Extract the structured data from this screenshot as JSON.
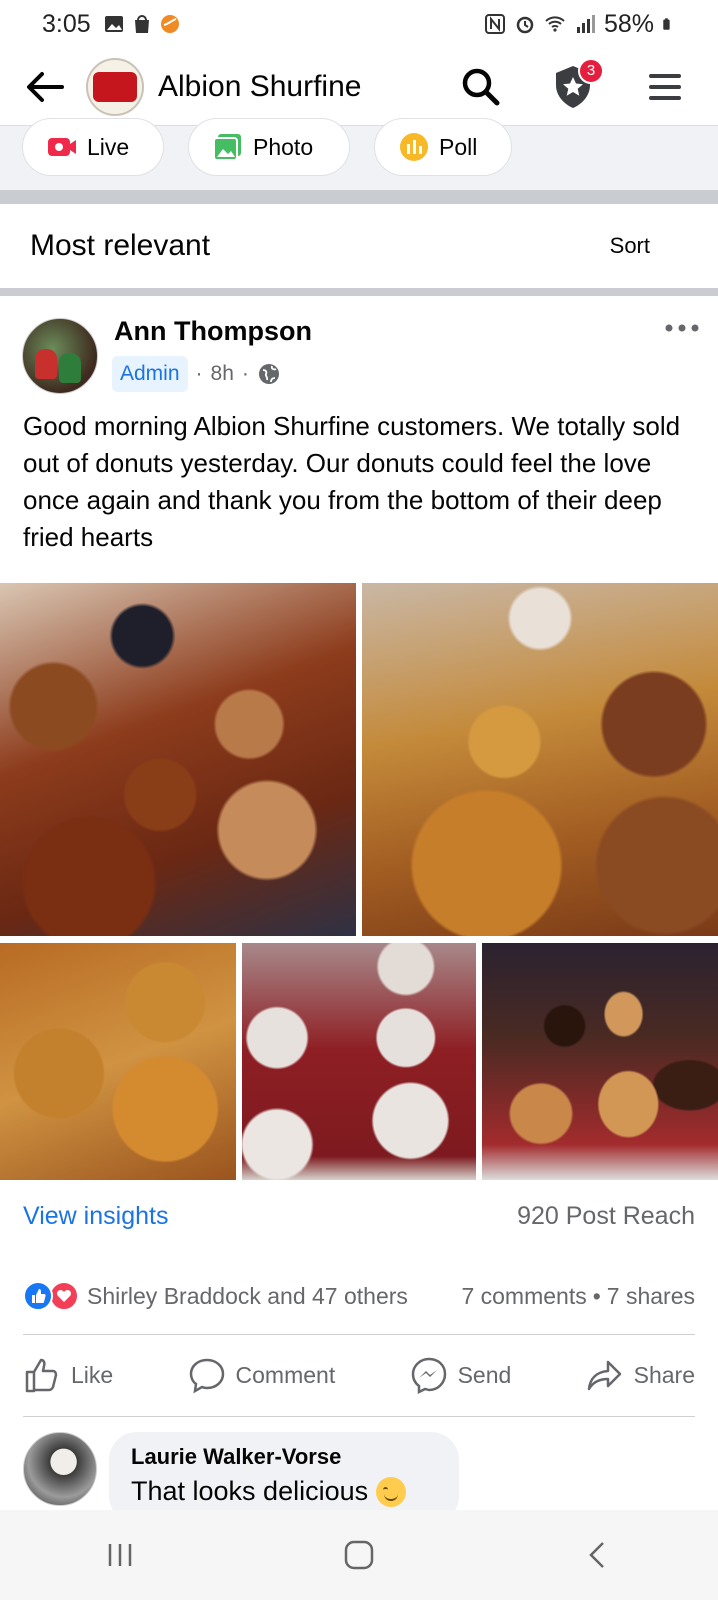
{
  "status_bar": {
    "time": "3:05",
    "battery": "58%"
  },
  "header": {
    "title": "Albion Shurfine",
    "notification_count": "3"
  },
  "composer": {
    "live_label": "Live",
    "photo_label": "Photo",
    "poll_label": "Poll"
  },
  "sort_bar": {
    "title": "Most relevant",
    "sort_label": "Sort"
  },
  "post": {
    "author": "Ann Thompson",
    "badge": "Admin",
    "time": "8h",
    "separator": "·",
    "text": "Good morning Albion Shurfine customers. We totally sold out of donuts yesterday. Our donuts could feel the love once again and thank you from the bottom of their deep fried hearts",
    "photo_count": 5
  },
  "insights": {
    "link": "View insights",
    "reach": "920 Post Reach"
  },
  "reactions": {
    "summary": "Shirley Braddock and 47 others",
    "comments": "7 comments",
    "dot": "•",
    "shares": "7 shares"
  },
  "actions": {
    "like": "Like",
    "comment": "Comment",
    "send": "Send",
    "share": "Share"
  },
  "comment": {
    "author": "Laurie Walker-Vorse",
    "text": "That looks delicious"
  },
  "colors": {
    "link_blue": "#1b74e4",
    "badge_red": "#e41e3f",
    "love_red": "#f33e58"
  }
}
